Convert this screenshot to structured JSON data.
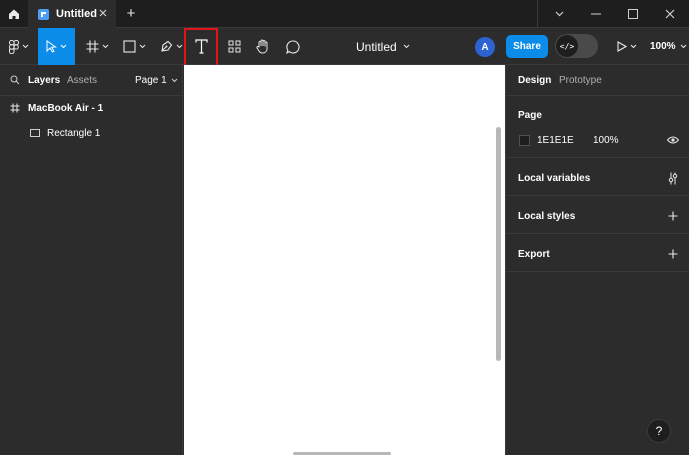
{
  "titlebar": {
    "tab_label": "Untitled",
    "add_tab_glyph": "+",
    "icons": [
      "home-icon",
      "figma-file-icon",
      "close-icon",
      "plus-icon",
      "chevron-down-icon",
      "minimize-icon",
      "maximize-icon",
      "close-window-icon"
    ]
  },
  "toolbar": {
    "doc_title": "Untitled",
    "avatar_initial": "A",
    "share_label": "Share",
    "dev_mode_glyph": "</>",
    "zoom_label": "100%",
    "tools": [
      "main-menu",
      "move",
      "frame",
      "shape",
      "pen",
      "text",
      "resources",
      "hand",
      "comment"
    ],
    "active_tool": "move",
    "highlighted_tool": "text"
  },
  "left_panel": {
    "tab_layers": "Layers",
    "tab_assets": "Assets",
    "page_selector": "Page 1",
    "layers": [
      {
        "name": "MacBook Air - 1",
        "type": "frame"
      },
      {
        "name": "Rectangle 1",
        "type": "rectangle"
      }
    ]
  },
  "right_panel": {
    "tab_design": "Design",
    "tab_prototype": "Prototype",
    "page_section": {
      "title": "Page",
      "bg_hex": "1E1E1E",
      "opacity": "100%"
    },
    "local_variables": "Local variables",
    "local_styles": "Local styles",
    "export": "Export"
  },
  "help_glyph": "?",
  "colors": {
    "accent": "#0c8ce9",
    "highlight_box": "#e0141a",
    "panel_bg": "#2c2c2c",
    "canvas_bg": "#ffffff",
    "page_swatch": "#1e1e1e"
  }
}
